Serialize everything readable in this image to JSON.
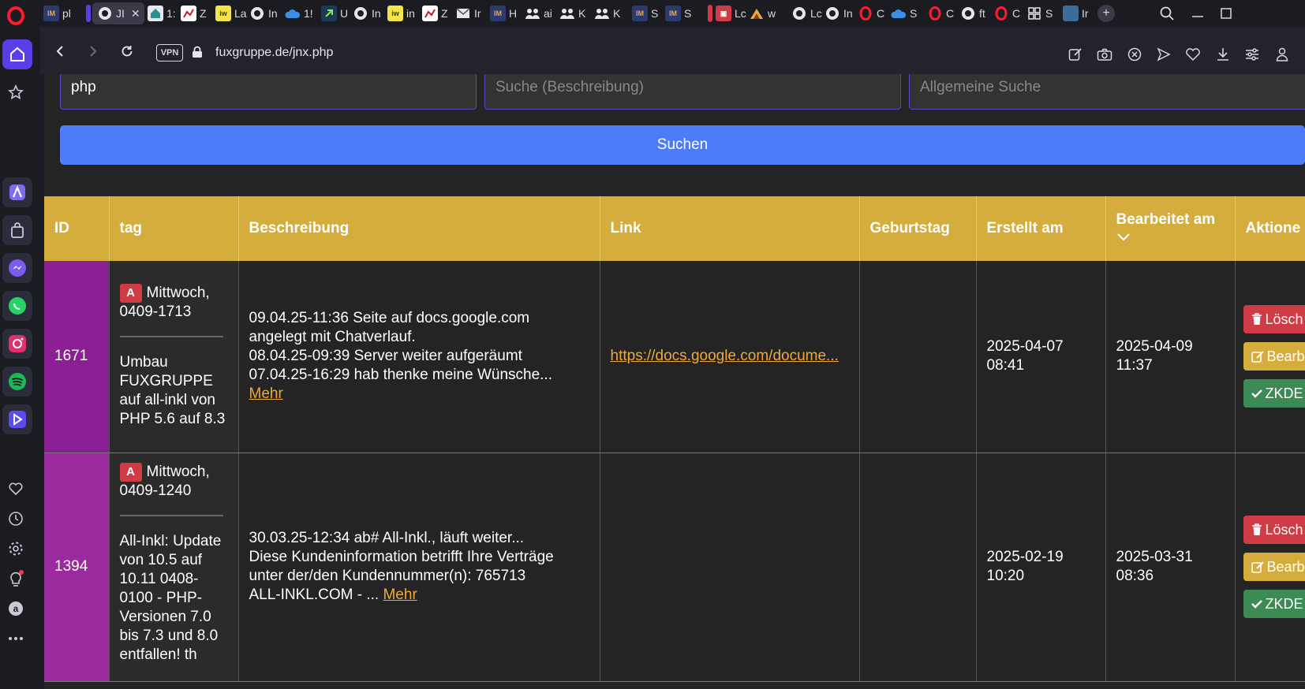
{
  "browser": {
    "tabs": [
      {
        "label": "pl",
        "favicon": "immo-icon"
      },
      {
        "label": "JI",
        "favicon": "globe-icon",
        "active": true
      },
      {
        "label": "1:",
        "favicon": "house-icon"
      },
      {
        "label": "Z",
        "favicon": "chart-icon"
      },
      {
        "label": "La",
        "favicon": "immowelt-icon"
      },
      {
        "label": "In",
        "favicon": "globe-icon"
      },
      {
        "label": "1!",
        "favicon": "cloud-icon"
      },
      {
        "label": "U",
        "favicon": "arrow-icon"
      },
      {
        "label": "In",
        "favicon": "globe-icon"
      },
      {
        "label": "in",
        "favicon": "immowelt-icon"
      },
      {
        "label": "Z",
        "favicon": "chart-icon"
      },
      {
        "label": "Ir",
        "favicon": "mail-icon"
      },
      {
        "label": "H",
        "favicon": "immo-icon"
      },
      {
        "label": "ai",
        "favicon": "people-icon"
      },
      {
        "label": "K",
        "favicon": "people-icon"
      },
      {
        "label": "K",
        "favicon": "people-icon"
      },
      {
        "label": "S",
        "favicon": "immo-icon"
      },
      {
        "label": "S",
        "favicon": "immo-icon"
      },
      {
        "label": "Lc",
        "favicon": "red-icon"
      },
      {
        "label": "w",
        "favicon": "mountain-icon"
      },
      {
        "label": "Lc",
        "favicon": "globe-icon"
      },
      {
        "label": "In",
        "favicon": "globe-icon"
      },
      {
        "label": "C",
        "favicon": "opera-icon"
      },
      {
        "label": "S",
        "favicon": "cloud-icon"
      },
      {
        "label": "C",
        "favicon": "opera-icon"
      },
      {
        "label": "ft",
        "favicon": "globe-icon"
      },
      {
        "label": "C",
        "favicon": "opera-icon"
      },
      {
        "label": "S",
        "favicon": "grid-icon"
      },
      {
        "label": "Ir",
        "favicon": "square-icon"
      }
    ],
    "url": "fuxgruppe.de/jnx.php",
    "vpn_label": "VPN"
  },
  "search": {
    "tag_value": "php",
    "desc_placeholder": "Suche (Beschreibung)",
    "general_placeholder": "Allgemeine Suche",
    "button_label": "Suchen"
  },
  "table": {
    "headers": {
      "id": "ID",
      "tag": "tag",
      "beschreibung": "Beschreibung",
      "link": "Link",
      "geburtstag": "Geburtstag",
      "erstellt": "Erstellt am",
      "bearbeitet": "Bearbeitet am",
      "aktionen": "Aktione"
    },
    "rows": [
      {
        "id": "1671",
        "badge": "A",
        "tag_date": "Mittwoch, 0409-1713",
        "tag_title": "Umbau FUXGRUPPE auf all-inkl von PHP 5.6 auf 8.3",
        "desc_lines": [
          "09.04.25-11:36 Seite auf docs.google.com angelegt mit Chatverlauf.",
          "08.04.25-09:39 Server weiter aufgeräumt",
          "07.04.25-16:29 hab thenke meine Wünsche..."
        ],
        "more": "Mehr",
        "link_text": "https://docs.google.com/docume...",
        "geburtstag": "",
        "erstellt": "2025-04-07 08:41",
        "bearbeitet": "2025-04-09 11:37",
        "actions": {
          "delete": "Lösch",
          "edit": "Bearb",
          "zkde": "ZKDE"
        }
      },
      {
        "id": "1394",
        "badge": "A",
        "tag_date": "Mittwoch, 0409-1240",
        "tag_title": "All-Inkl: Update von 10.5 auf 10.11 0408-0100 - PHP-Versionen 7.0 bis 7.3 und 8.0 entfallen! th",
        "desc_lines": [
          "30.03.25-12:34 ab# All-Inkl., läuft weiter...",
          "Diese Kundeninformation betrifft Ihre Verträge unter der/den Kundennummer(n): 765713",
          "ALL-INKL.COM - ..."
        ],
        "more": "Mehr",
        "link_text": "",
        "geburtstag": "",
        "erstellt": "2025-02-19 10:20",
        "bearbeitet": "2025-03-31 08:36",
        "actions": {
          "delete": "Lösch",
          "edit": "Bearb",
          "zkde": "ZKDE"
        }
      }
    ]
  },
  "colors": {
    "header_bg": "#d4ad3c",
    "id_cell_bg": "#8b1f94",
    "search_button": "#4d7cf6",
    "delete_button": "#d03c45",
    "edit_button": "#d4ad3c",
    "ok_button": "#3e8a54",
    "link": "#f0a938"
  }
}
